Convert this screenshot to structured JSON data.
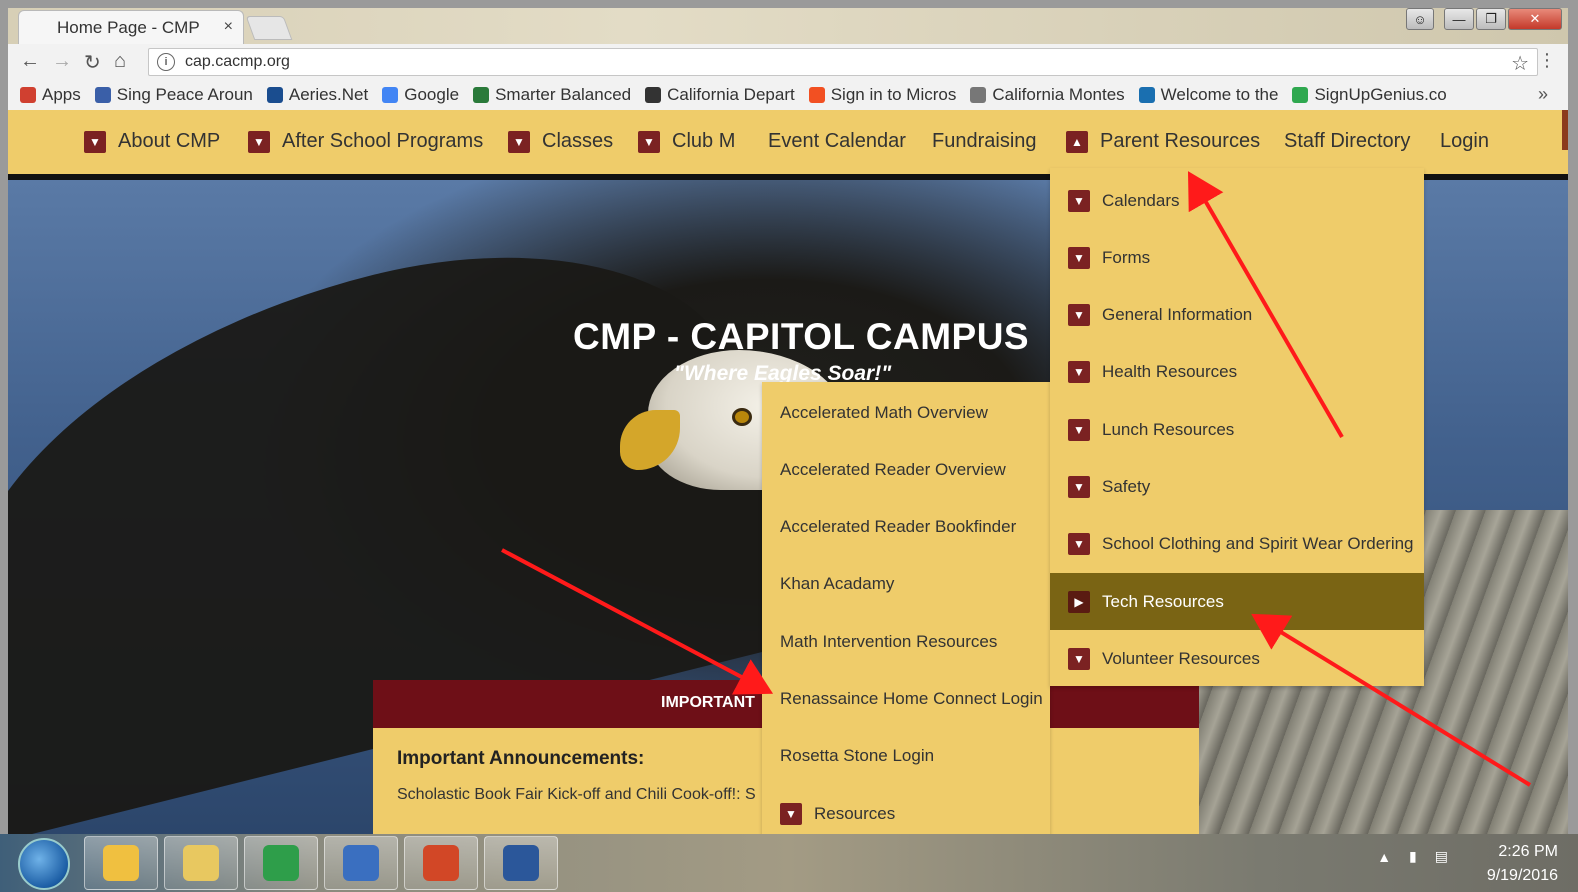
{
  "browser": {
    "tab_title": "Home Page - CMP",
    "tab_close": "×",
    "url": "cap.cacmp.org",
    "menu": "⋮",
    "bookmarks_more": "»",
    "bookmarks": [
      {
        "label": "Apps",
        "color": "#d04030"
      },
      {
        "label": "Sing Peace Aroun",
        "color": "#3a5fa8"
      },
      {
        "label": "Aeries.Net",
        "color": "#1a4d8f"
      },
      {
        "label": "Google",
        "color": "#4285f4"
      },
      {
        "label": "Smarter Balanced",
        "color": "#2a7a3a"
      },
      {
        "label": "California Depart",
        "color": "#333333"
      },
      {
        "label": "Sign in to Micros",
        "color": "#f25022"
      },
      {
        "label": "California Montes",
        "color": "#777777"
      },
      {
        "label": "Welcome to the",
        "color": "#1a6fb0"
      },
      {
        "label": "SignUpGenius.co",
        "color": "#2fa84f"
      }
    ]
  },
  "site": {
    "nav": [
      {
        "label": "About CMP",
        "has_chevron": true
      },
      {
        "label": "After School Programs",
        "has_chevron": true
      },
      {
        "label": "Classes",
        "has_chevron": true
      },
      {
        "label": "Club M",
        "has_chevron": true
      },
      {
        "label": "Event Calendar",
        "has_chevron": false
      },
      {
        "label": "Fundraising",
        "has_chevron": false
      },
      {
        "label": "Parent Resources",
        "has_chevron": true
      },
      {
        "label": "Staff Directory",
        "has_chevron": false
      },
      {
        "label": "Login",
        "has_chevron": false
      }
    ],
    "title": "CMP - CAPITOL CAMPUS",
    "tagline": "\"Where Eagles Soar!\"",
    "announce_bar": "IMPORTANT",
    "announce_heading": "Important Announcements:",
    "announce_text": "Scholastic Book Fair Kick-off and Chili Cook-off!: S"
  },
  "parent_resources_menu": [
    {
      "label": "Calendars"
    },
    {
      "label": "Forms"
    },
    {
      "label": "General Information"
    },
    {
      "label": "Health Resources"
    },
    {
      "label": "Lunch Resources"
    },
    {
      "label": "Safety"
    },
    {
      "label": "School Clothing and Spirit Wear Ordering"
    },
    {
      "label": "Tech Resources",
      "active": true
    },
    {
      "label": "Volunteer Resources"
    }
  ],
  "tech_resources_menu": [
    {
      "label": "Accelerated Math Overview",
      "has_chevron": false
    },
    {
      "label": "Accelerated Reader Overview",
      "has_chevron": false
    },
    {
      "label": "Accelerated Reader Bookfinder",
      "has_chevron": false
    },
    {
      "label": "Khan Acadamy",
      "has_chevron": false
    },
    {
      "label": "Math Intervention Resources",
      "has_chevron": false
    },
    {
      "label": "Renassaince Home Connect Login",
      "has_chevron": false
    },
    {
      "label": "Rosetta Stone Login",
      "has_chevron": false
    },
    {
      "label": "Resources",
      "has_chevron": true
    }
  ],
  "taskbar": {
    "time": "2:26 PM",
    "date": "9/19/2016",
    "apps": [
      {
        "name": "outlook-icon",
        "color": "#f0c040"
      },
      {
        "name": "explorer-icon",
        "color": "#e8c860"
      },
      {
        "name": "chrome-icon",
        "color": "#2e9e4a"
      },
      {
        "name": "app-blue-icon",
        "color": "#3a6fc0"
      },
      {
        "name": "powerpoint-icon",
        "color": "#d24726"
      },
      {
        "name": "word-icon",
        "color": "#2b579a"
      }
    ]
  },
  "colors": {
    "nav_bg": "#efcc6a",
    "chevron": "#7b2222",
    "active_item": "#7a6414",
    "announce_bar": "#6e0f17",
    "arrow": "#ff1a1a"
  }
}
